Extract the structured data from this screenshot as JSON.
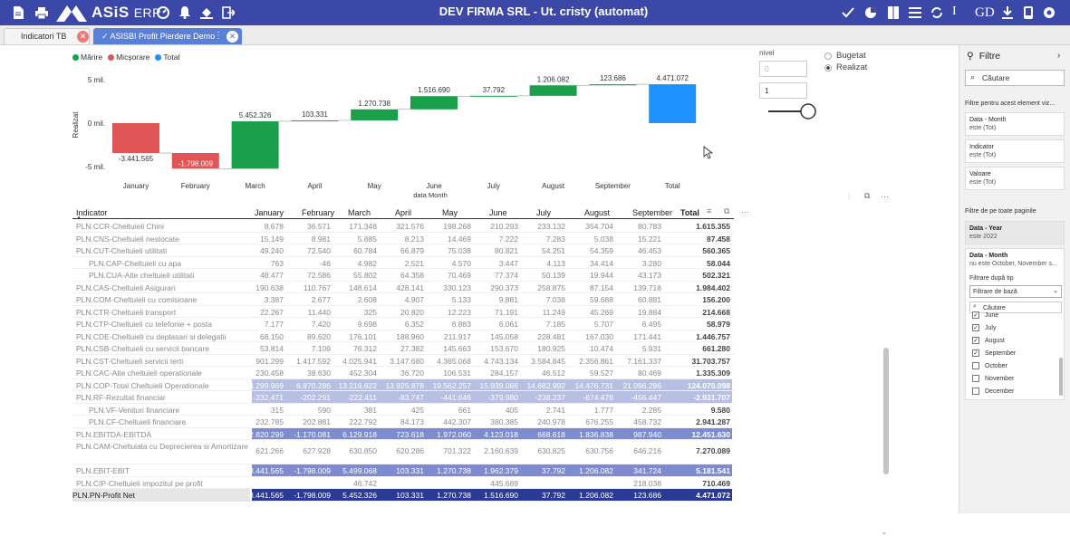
{
  "topbar": {
    "brand": "ASiS",
    "brand_suffix": "ERP",
    "title": "DEV FIRMA SRL - Ut. cristy (automat)",
    "user": "GD",
    "cursor_text": "I"
  },
  "tabs": [
    {
      "label": "Indicatori TB",
      "active": false
    },
    {
      "label": "✓ ASISBI Profit Pierdere Demo",
      "active": true
    }
  ],
  "chart": {
    "legend": [
      {
        "label": "Mărire",
        "color": "#1a9f4b"
      },
      {
        "label": "Micșorare",
        "color": "#e05555"
      },
      {
        "label": "Total",
        "color": "#1e90ff"
      }
    ],
    "ylabel": "Realizat",
    "xlabel": "data Month",
    "yticks": [
      "5 mil.",
      "0 mil.",
      "-5 mil."
    ]
  },
  "chart_data": {
    "type": "bar",
    "subtype": "waterfall",
    "categories": [
      "January",
      "February",
      "March",
      "April",
      "May",
      "June",
      "July",
      "August",
      "September",
      "Total"
    ],
    "values": [
      -3441565,
      -1798009,
      5452326,
      103331,
      1270738,
      1516690,
      37792,
      1206082,
      123686,
      4471072
    ],
    "labels": [
      "-3.441.565",
      "-1.798.009",
      "5.452.326",
      "103.331",
      "1.270.738",
      "1.516.690",
      "37.792",
      "1.206.082",
      "123.686",
      "4.471.072"
    ],
    "xlabel": "data Month",
    "ylabel": "Realizat",
    "ylim": [
      -5500000,
      5500000
    ],
    "legend": [
      "Mărire",
      "Micșorare",
      "Total"
    ]
  },
  "controls": {
    "nivel_label": "nivel",
    "nivel_min": "0",
    "nivel_value": "1",
    "radio_options": [
      {
        "label": "Bugetat",
        "selected": false
      },
      {
        "label": "Realizat",
        "selected": true
      }
    ]
  },
  "table": {
    "headers": [
      "Indicator",
      "January",
      "February",
      "March",
      "April",
      "May",
      "June",
      "July",
      "August",
      "September",
      "Total"
    ],
    "rows": [
      {
        "label": "PLN.CCR-Cheltuieli Chini",
        "values": [
          "8.678",
          "36.571",
          "171.348",
          "321.576",
          "198.268",
          "210.293",
          "233.132",
          "354.704",
          "80.783",
          "1.615.355"
        ],
        "style": "normal",
        "indent": 0
      },
      {
        "label": "PLN.CNS-Cheltuieli nestocate",
        "values": [
          "15.149",
          "8.981",
          "5.885",
          "8.213",
          "14.469",
          "7.222",
          "7.283",
          "5.038",
          "15.221",
          "87.458"
        ],
        "style": "normal",
        "indent": 0
      },
      {
        "label": "PLN.CUT-Cheltuieli utilitati",
        "values": [
          "49.240",
          "72.540",
          "60.784",
          "66.879",
          "75.038",
          "80.821",
          "54.251",
          "54.359",
          "46.453",
          "560.365"
        ],
        "style": "normal",
        "indent": 0
      },
      {
        "label": "PLN.CAP-Cheltuieli cu apa",
        "values": [
          "763",
          "-46",
          "4.982",
          "2.521",
          "4.570",
          "3.447",
          "4.113",
          "34.414",
          "3.280",
          "58.044"
        ],
        "style": "normal",
        "indent": 1
      },
      {
        "label": "PLN.CUA-Alte cheltuieli utilitati",
        "values": [
          "48.477",
          "72.586",
          "55.802",
          "64.358",
          "70.469",
          "77.374",
          "50.139",
          "19.944",
          "43.173",
          "502.321"
        ],
        "style": "normal",
        "indent": 1
      },
      {
        "label": "PLN.CAS-Cheltuieli Asigurari",
        "values": [
          "190.638",
          "110.767",
          "148.614",
          "428.141",
          "330.123",
          "290.373",
          "258.875",
          "87.154",
          "139.718",
          "1.984.402"
        ],
        "style": "normal",
        "indent": 0
      },
      {
        "label": "PLN.COM-Cheltuieli cu comisioane",
        "values": [
          "3.387",
          "2.677",
          "2.608",
          "4.907",
          "5.133",
          "9.881",
          "7.038",
          "59.688",
          "60.881",
          "156.200"
        ],
        "style": "normal",
        "indent": 0
      },
      {
        "label": "PLN.CTR-Cheltuieli transport",
        "values": [
          "22.267",
          "11.440",
          "325",
          "20.820",
          "12.223",
          "71.191",
          "11.249",
          "45.269",
          "19.884",
          "214.668"
        ],
        "style": "normal",
        "indent": 0
      },
      {
        "label": "PLN.CTP-Cheltuieli cu telefonie + posta",
        "values": [
          "7.177",
          "7.420",
          "9.698",
          "6.352",
          "6.883",
          "6.061",
          "7.185",
          "5.707",
          "6.495",
          "58.979"
        ],
        "style": "normal",
        "indent": 0
      },
      {
        "label": "PLN.CDE-Cheltuieli cu deplasari si delegatii",
        "values": [
          "68.150",
          "89.620",
          "176.101",
          "188.960",
          "211.917",
          "145.058",
          "228.481",
          "167.030",
          "171.441",
          "1.446.757"
        ],
        "style": "normal",
        "indent": 0
      },
      {
        "label": "PLN.CSB-Cheltuieli cu servicii bancare",
        "values": [
          "53.814",
          "7.109",
          "76.312",
          "27.382",
          "145.663",
          "153.670",
          "180.925",
          "10.474",
          "5.931",
          "661.280"
        ],
        "style": "normal",
        "indent": 0
      },
      {
        "label": "PLN.CST-Cheltuieli servicii terti",
        "values": [
          "901.299",
          "1.417.592",
          "4.025.941",
          "3.147.680",
          "4.365.068",
          "4.743.134",
          "3.584.845",
          "2.356.861",
          "7.161.337",
          "31.703.757"
        ],
        "style": "normal",
        "indent": 0
      },
      {
        "label": "PLN.CAC-Alte cheltuieli operationale",
        "values": [
          "230.458",
          "38.630",
          "452.304",
          "36.720",
          "106.531",
          "284.157",
          "46.512",
          "59.527",
          "80.469",
          "1.335.309"
        ],
        "style": "normal",
        "indent": 0
      },
      {
        "label": "PLN.COP-Total Cheltuieli Operationale",
        "values": [
          "4.299.969",
          "6.870.286",
          "13.216.622",
          "13.925.878",
          "19.562.257",
          "15.939.066",
          "14.682.992",
          "14.476.731",
          "21.096.296",
          "124.070.098"
        ],
        "style": "band",
        "indent": 0
      },
      {
        "label": "PLN.RF-Rezultat financiar",
        "values": [
          "-232.471",
          "-202.291",
          "-222.411",
          "-83.747",
          "-441.646",
          "-379.980",
          "-238.237",
          "-674.478",
          "-456.447",
          "-2.931.707"
        ],
        "style": "band",
        "indent": 0
      },
      {
        "label": "PLN.VF-Venituri financiare",
        "values": [
          "315",
          "590",
          "381",
          "425",
          "661",
          "405",
          "2.741",
          "1.777",
          "2.285",
          "9.580"
        ],
        "style": "normal",
        "indent": 1
      },
      {
        "label": "PLN.CF-Cheltuieli financiare",
        "values": [
          "232.785",
          "202.881",
          "222.792",
          "84.173",
          "442.307",
          "380.385",
          "240.978",
          "676.255",
          "458.732",
          "2.941.287"
        ],
        "style": "normal",
        "indent": 1
      },
      {
        "label": "PLN.EBITDA-EBITDA",
        "values": [
          "-2.820.299",
          "-1.170.081",
          "6.129.918",
          "723.618",
          "1.972.060",
          "4.123.018",
          "668.618",
          "1.836.838",
          "987.940",
          "12.451.630"
        ],
        "style": "bandd",
        "indent": 0
      },
      {
        "label": "PLN.CAM-Cheltuiala cu Deprecierea si Amortizare",
        "values": [
          "621.266",
          "627.928",
          "630.850",
          "620.286",
          "701.322",
          "2.160.639",
          "630.825",
          "630.756",
          "646.216",
          "7.270.089"
        ],
        "style": "normal",
        "indent": 0,
        "tall": true
      },
      {
        "label": "PLN.EBIT-EBIT",
        "values": [
          "-3.441.565",
          "-1.798.009",
          "5.499.068",
          "103.331",
          "1.270.738",
          "1.962.379",
          "37.792",
          "1.206.082",
          "341.724",
          "5.181.541"
        ],
        "style": "bandd",
        "indent": 0
      },
      {
        "label": "PLN.CIP-Cheltuieli impozitul pe profit",
        "values": [
          "",
          "",
          "46.742",
          "",
          "",
          "445.689",
          "",
          "",
          "218.038",
          "710.469"
        ],
        "style": "normal",
        "indent": 0
      },
      {
        "label": "PLN.PN-Profit Net",
        "values": [
          "-3.441.565",
          "-1.798.009",
          "5.452.326",
          "103.331",
          "1.270.738",
          "1.516.690",
          "37.792",
          "1.206.082",
          "123.686",
          "4.471.072"
        ],
        "style": "final",
        "indent": 0
      }
    ]
  },
  "filters": {
    "title": "Filtre",
    "search_placeholder": "Căutare",
    "section_visual": "Filtre pentru acest element viz...",
    "visual_cards": [
      {
        "title": "Data - Month",
        "sub": "este (Tot)"
      },
      {
        "title": "Indicator",
        "sub": "este (Tot)"
      },
      {
        "title": "Valoare",
        "sub": "este (Tot)"
      }
    ],
    "section_page": "Filtre de pe toate paginile",
    "year_card": {
      "title": "Data - Year",
      "sub": "este 2022"
    },
    "month_card": {
      "title": "Data - Month",
      "sub": "nu este October, November s..."
    },
    "filter_type_label": "Filtrare după tip",
    "filter_type_value": "Filtrare de bază",
    "list_search": "Căutare",
    "month_items": [
      {
        "label": "June",
        "checked": true
      },
      {
        "label": "July",
        "checked": true
      },
      {
        "label": "August",
        "checked": true
      },
      {
        "label": "September",
        "checked": true
      },
      {
        "label": "October",
        "checked": false
      },
      {
        "label": "November",
        "checked": false
      },
      {
        "label": "December",
        "checked": false
      }
    ]
  }
}
